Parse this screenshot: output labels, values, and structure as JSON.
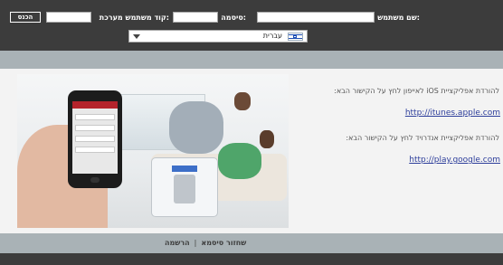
{
  "header": {
    "username_label": "שם משתמש:",
    "password_label": "סיסמה:",
    "system_code_label": "קוד משתמש מערכת:",
    "username_value": "",
    "password_value": "",
    "system_code_value": "",
    "login_label": "הכנס",
    "language": {
      "selected": "עברית",
      "flag_icon": "israel-flag-icon"
    }
  },
  "content": {
    "ios_text": "להורדת אפליקציית iOS לאייפון לחץ על הקישור הבא:",
    "ios_link": "http://itunes.apple.com",
    "android_text": "להורדת אפליקציית אנדרויד לחץ על הקישור הבא:",
    "android_link": "http://play.google.com"
  },
  "footer": {
    "register_label": "הרשמה",
    "separator": "|",
    "reset_password_label": "שחזור סיסמא"
  },
  "colors": {
    "header_bg": "#3c3c3c",
    "band_bg": "#a9b2b6",
    "content_bg": "#f3f3f3",
    "link": "#2d3e9b"
  }
}
